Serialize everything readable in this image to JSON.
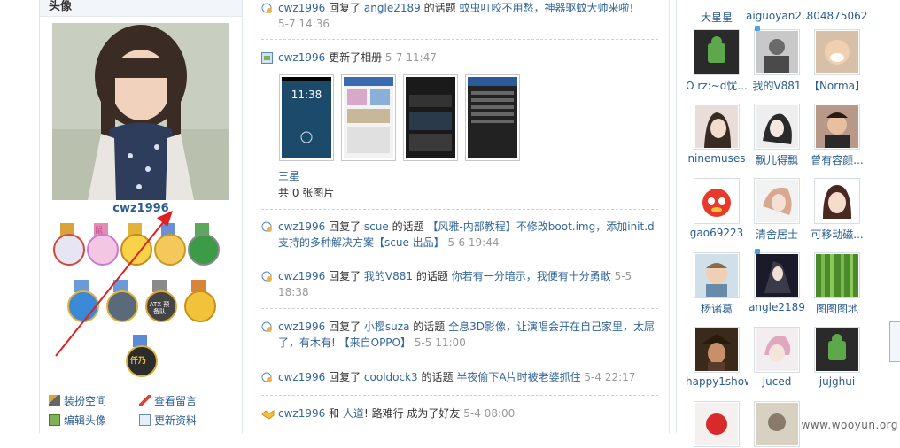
{
  "left": {
    "header": "头像",
    "username": "cwz1996",
    "links": {
      "dress_up": "装扮空间",
      "view_messages": "查看留言",
      "edit_avatar": "编辑头像",
      "update_profile": "更新资料"
    },
    "medal_labels": [
      "鼠",
      "ATX 预备队",
      "仟乃"
    ]
  },
  "feed": {
    "items": [
      {
        "user": "cwz1996",
        "action": "回复了",
        "target": "angle2189",
        "mid": "的话题",
        "topic": "蚊虫叮咬不用愁，神器驱蚊大帅来啦!",
        "time": "5-7 14:36"
      },
      {
        "user": "cwz1996",
        "action": "更新了相册",
        "time": "5-7 11:47",
        "album_title": "三星",
        "album_count": "共 0 张图片"
      },
      {
        "user": "cwz1996",
        "action": "回复了",
        "target": "scue",
        "mid": "的话题",
        "topic": "【风雅-内部教程】不修改boot.img，添加init.d支持的多种解决方案【scue 出品】",
        "time": "5-6 19:44"
      },
      {
        "user": "cwz1996",
        "action": "回复了",
        "target": "我的V881",
        "mid": "的话题",
        "topic": "你若有一分暗示，我便有十分勇敢",
        "time": "5-5 18:38"
      },
      {
        "user": "cwz1996",
        "action": "回复了",
        "target": "小樱suza",
        "mid": "的话题",
        "topic": "全息3D影像，让演唱会开在自己家里，太屌了，有木有! 【来自OPPO】",
        "time": "5-5 11:00"
      },
      {
        "user": "cwz1996",
        "action": "回复了",
        "target": "cooldock3",
        "mid": "的话题",
        "topic": "半夜偷下A片时被老婆抓住",
        "time": "5-4 22:17"
      },
      {
        "user": "cwz1996",
        "action": "和",
        "target": "人道",
        "mid": "!",
        "topic": "路难行",
        "suffix": "成为了好友",
        "time": "5-4 08:00"
      }
    ],
    "screenshot_clock": "11:38"
  },
  "friends": [
    {
      "name": "大星星"
    },
    {
      "name": "aiguoyan2..."
    },
    {
      "name": "804875062"
    },
    {
      "name": "O rz:~d忧..."
    },
    {
      "name": "我的V881"
    },
    {
      "name": "【Norma】"
    },
    {
      "name": "ninemuses"
    },
    {
      "name": "飘儿得飘"
    },
    {
      "name": "曾有容颜..."
    },
    {
      "name": "gao69223"
    },
    {
      "name": "清舍居士"
    },
    {
      "name": "可移动磁..."
    },
    {
      "name": "杨诸葛"
    },
    {
      "name": "angle2189"
    },
    {
      "name": "图图图地"
    },
    {
      "name": "happy1show"
    },
    {
      "name": "Juced"
    },
    {
      "name": "jujghui"
    }
  ],
  "watermark": "www.wooyun.org",
  "colors": {
    "link": "#336699",
    "time": "#999999",
    "border": "#dfe6ec"
  }
}
